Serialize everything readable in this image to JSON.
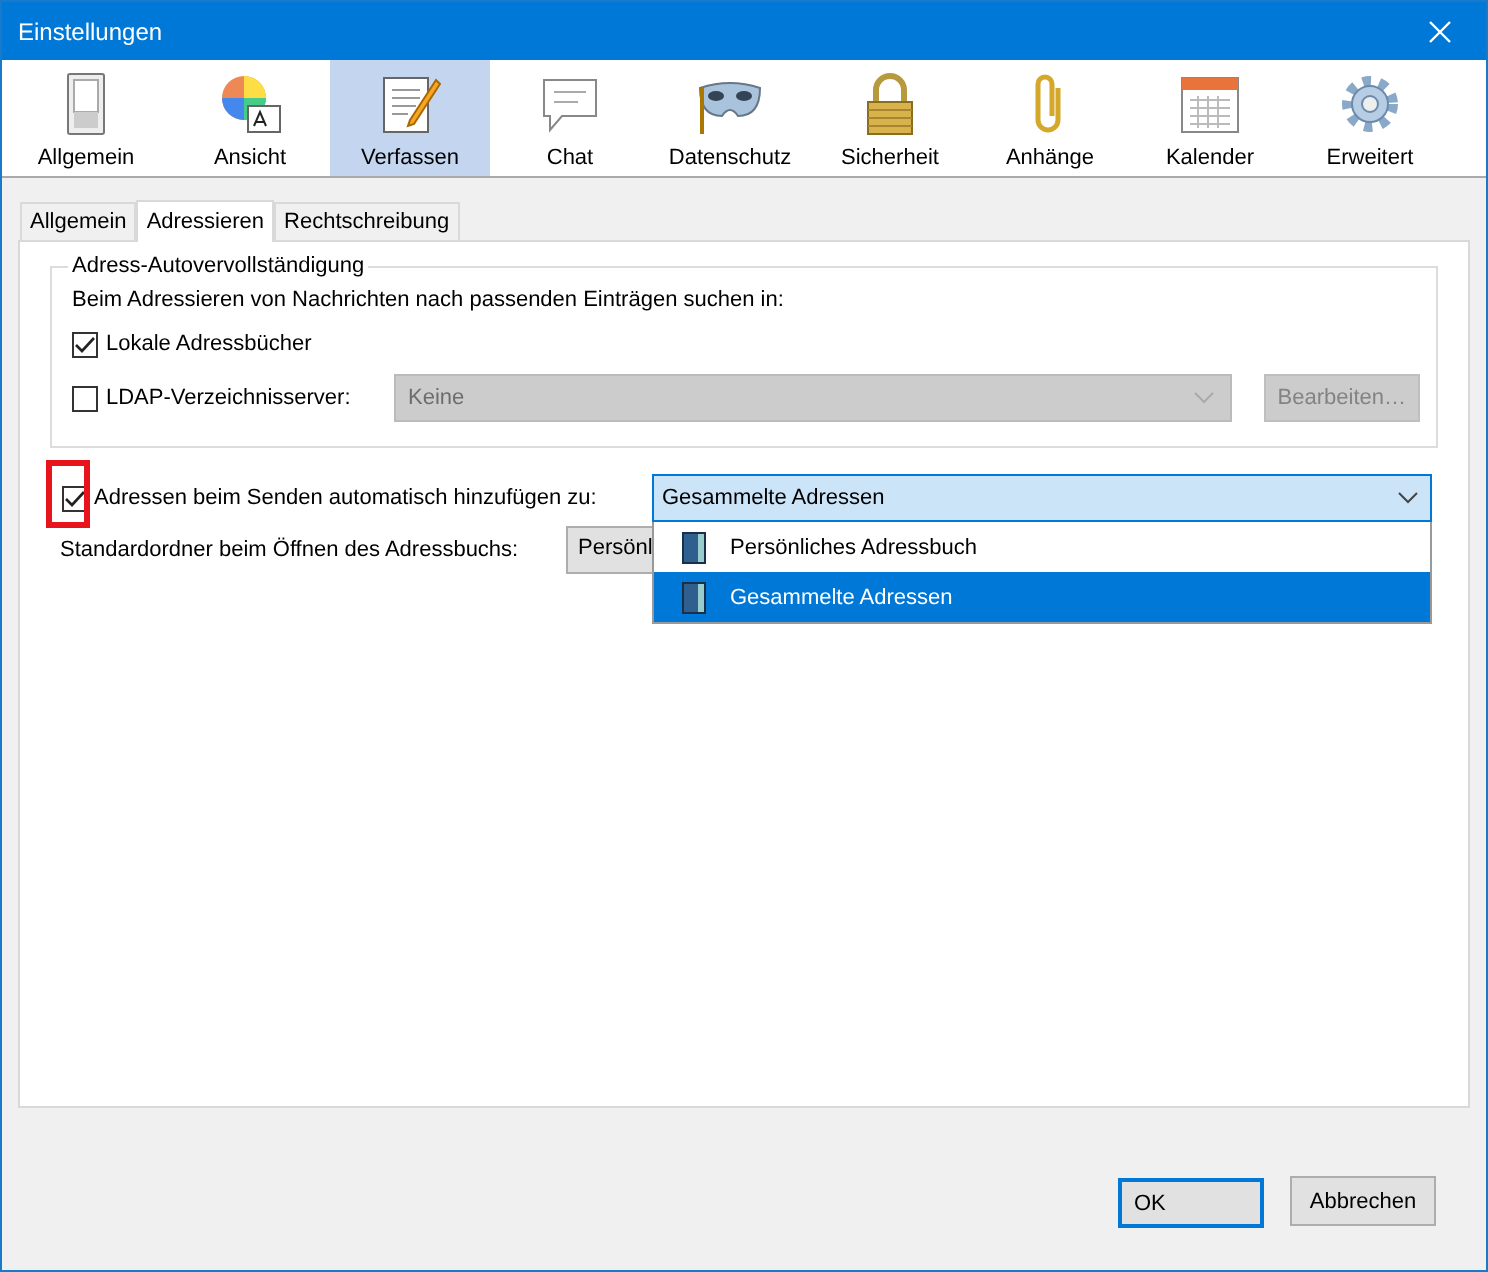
{
  "window": {
    "title": "Einstellungen"
  },
  "toolbar": [
    {
      "label": "Allgemein",
      "kind": "switch",
      "selected": false
    },
    {
      "label": "Ansicht",
      "kind": "palette",
      "selected": false
    },
    {
      "label": "Verfassen",
      "kind": "compose",
      "selected": true
    },
    {
      "label": "Chat",
      "kind": "chat",
      "selected": false
    },
    {
      "label": "Datenschutz",
      "kind": "mask",
      "selected": false
    },
    {
      "label": "Sicherheit",
      "kind": "lock",
      "selected": false
    },
    {
      "label": "Anhänge",
      "kind": "clip",
      "selected": false
    },
    {
      "label": "Kalender",
      "kind": "calendar",
      "selected": false
    },
    {
      "label": "Erweitert",
      "kind": "gear",
      "selected": false
    }
  ],
  "tabs": [
    {
      "label": "Allgemein",
      "selected": false
    },
    {
      "label": "Adressieren",
      "selected": true
    },
    {
      "label": "Rechtschreibung",
      "selected": false
    }
  ],
  "autocomplete_group": {
    "title": "Adress-Autovervollständigung",
    "description": "Beim Adressieren von Nachrichten nach passenden Einträgen suchen in:",
    "local": {
      "label": "Lokale Adressbücher",
      "checked": true
    },
    "ldap": {
      "label": "LDAP-Verzeichnisserver:",
      "checked": false,
      "select": {
        "value": "Keine",
        "disabled": true
      },
      "button": {
        "label": "Bearbeiten…",
        "disabled": true
      }
    }
  },
  "auto_add": {
    "label": "Adressen beim Senden automatisch hinzufügen zu:",
    "checked": true,
    "highlighted": true,
    "select": {
      "value": "Gesammelte Adressen",
      "expanded": true,
      "options": [
        {
          "label": "Persönliches Adressbuch",
          "selected": false
        },
        {
          "label": "Gesammelte Adressen",
          "selected": true
        }
      ]
    }
  },
  "default_folder": {
    "label": "Standardordner beim Öffnen des Adressbuchs:",
    "value": "Persönl"
  },
  "buttons": [
    {
      "label": "OK",
      "default": true
    },
    {
      "label": "Abbrechen",
      "default": false
    }
  ]
}
